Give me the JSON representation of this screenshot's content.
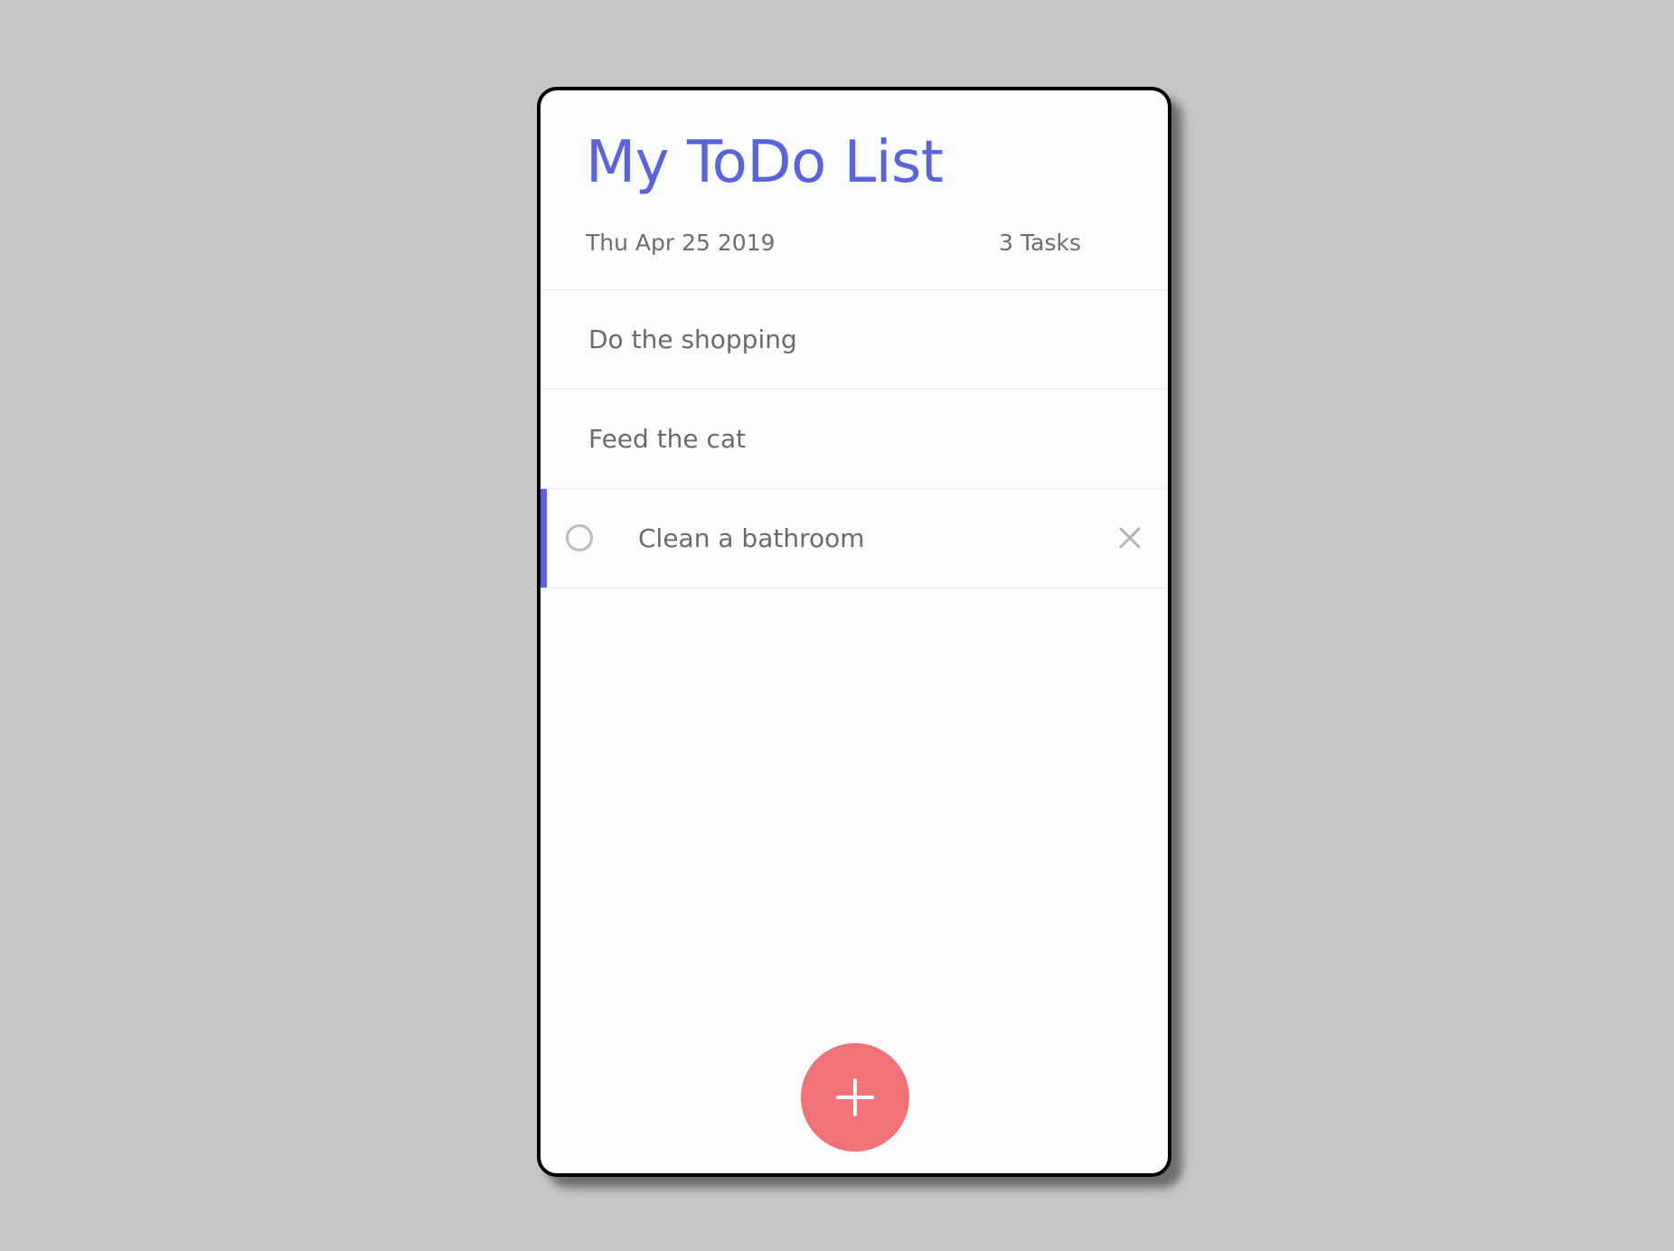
{
  "header": {
    "title": "My ToDo List",
    "date": "Thu Apr 25 2019",
    "task_count": "3 Tasks"
  },
  "tasks": [
    {
      "label": "Do the shopping"
    },
    {
      "label": "Feed the cat"
    },
    {
      "label": "Clean a bathroom"
    }
  ],
  "icons": {
    "complete": "circle-checkbox-icon",
    "delete": "close-icon",
    "add": "plus-icon"
  },
  "colors": {
    "accent": "#5b63db",
    "add_button": "#f07276",
    "background": "#c6c6c6",
    "card": "#f9fbfd",
    "text": "#6b6b6b"
  }
}
